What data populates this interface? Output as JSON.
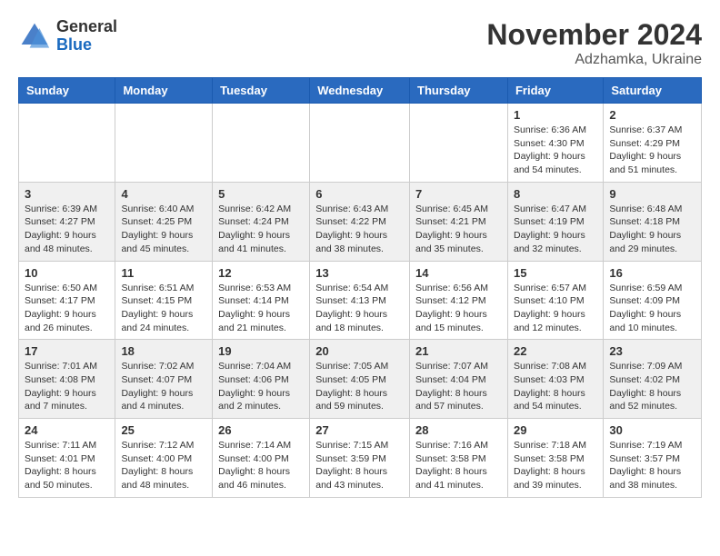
{
  "logo": {
    "general": "General",
    "blue": "Blue"
  },
  "title": "November 2024",
  "location": "Adzhamka, Ukraine",
  "days_of_week": [
    "Sunday",
    "Monday",
    "Tuesday",
    "Wednesday",
    "Thursday",
    "Friday",
    "Saturday"
  ],
  "weeks": [
    [
      {
        "day": "",
        "info": ""
      },
      {
        "day": "",
        "info": ""
      },
      {
        "day": "",
        "info": ""
      },
      {
        "day": "",
        "info": ""
      },
      {
        "day": "",
        "info": ""
      },
      {
        "day": "1",
        "info": "Sunrise: 6:36 AM\nSunset: 4:30 PM\nDaylight: 9 hours and 54 minutes."
      },
      {
        "day": "2",
        "info": "Sunrise: 6:37 AM\nSunset: 4:29 PM\nDaylight: 9 hours and 51 minutes."
      }
    ],
    [
      {
        "day": "3",
        "info": "Sunrise: 6:39 AM\nSunset: 4:27 PM\nDaylight: 9 hours and 48 minutes."
      },
      {
        "day": "4",
        "info": "Sunrise: 6:40 AM\nSunset: 4:25 PM\nDaylight: 9 hours and 45 minutes."
      },
      {
        "day": "5",
        "info": "Sunrise: 6:42 AM\nSunset: 4:24 PM\nDaylight: 9 hours and 41 minutes."
      },
      {
        "day": "6",
        "info": "Sunrise: 6:43 AM\nSunset: 4:22 PM\nDaylight: 9 hours and 38 minutes."
      },
      {
        "day": "7",
        "info": "Sunrise: 6:45 AM\nSunset: 4:21 PM\nDaylight: 9 hours and 35 minutes."
      },
      {
        "day": "8",
        "info": "Sunrise: 6:47 AM\nSunset: 4:19 PM\nDaylight: 9 hours and 32 minutes."
      },
      {
        "day": "9",
        "info": "Sunrise: 6:48 AM\nSunset: 4:18 PM\nDaylight: 9 hours and 29 minutes."
      }
    ],
    [
      {
        "day": "10",
        "info": "Sunrise: 6:50 AM\nSunset: 4:17 PM\nDaylight: 9 hours and 26 minutes."
      },
      {
        "day": "11",
        "info": "Sunrise: 6:51 AM\nSunset: 4:15 PM\nDaylight: 9 hours and 24 minutes."
      },
      {
        "day": "12",
        "info": "Sunrise: 6:53 AM\nSunset: 4:14 PM\nDaylight: 9 hours and 21 minutes."
      },
      {
        "day": "13",
        "info": "Sunrise: 6:54 AM\nSunset: 4:13 PM\nDaylight: 9 hours and 18 minutes."
      },
      {
        "day": "14",
        "info": "Sunrise: 6:56 AM\nSunset: 4:12 PM\nDaylight: 9 hours and 15 minutes."
      },
      {
        "day": "15",
        "info": "Sunrise: 6:57 AM\nSunset: 4:10 PM\nDaylight: 9 hours and 12 minutes."
      },
      {
        "day": "16",
        "info": "Sunrise: 6:59 AM\nSunset: 4:09 PM\nDaylight: 9 hours and 10 minutes."
      }
    ],
    [
      {
        "day": "17",
        "info": "Sunrise: 7:01 AM\nSunset: 4:08 PM\nDaylight: 9 hours and 7 minutes."
      },
      {
        "day": "18",
        "info": "Sunrise: 7:02 AM\nSunset: 4:07 PM\nDaylight: 9 hours and 4 minutes."
      },
      {
        "day": "19",
        "info": "Sunrise: 7:04 AM\nSunset: 4:06 PM\nDaylight: 9 hours and 2 minutes."
      },
      {
        "day": "20",
        "info": "Sunrise: 7:05 AM\nSunset: 4:05 PM\nDaylight: 8 hours and 59 minutes."
      },
      {
        "day": "21",
        "info": "Sunrise: 7:07 AM\nSunset: 4:04 PM\nDaylight: 8 hours and 57 minutes."
      },
      {
        "day": "22",
        "info": "Sunrise: 7:08 AM\nSunset: 4:03 PM\nDaylight: 8 hours and 54 minutes."
      },
      {
        "day": "23",
        "info": "Sunrise: 7:09 AM\nSunset: 4:02 PM\nDaylight: 8 hours and 52 minutes."
      }
    ],
    [
      {
        "day": "24",
        "info": "Sunrise: 7:11 AM\nSunset: 4:01 PM\nDaylight: 8 hours and 50 minutes."
      },
      {
        "day": "25",
        "info": "Sunrise: 7:12 AM\nSunset: 4:00 PM\nDaylight: 8 hours and 48 minutes."
      },
      {
        "day": "26",
        "info": "Sunrise: 7:14 AM\nSunset: 4:00 PM\nDaylight: 8 hours and 46 minutes."
      },
      {
        "day": "27",
        "info": "Sunrise: 7:15 AM\nSunset: 3:59 PM\nDaylight: 8 hours and 43 minutes."
      },
      {
        "day": "28",
        "info": "Sunrise: 7:16 AM\nSunset: 3:58 PM\nDaylight: 8 hours and 41 minutes."
      },
      {
        "day": "29",
        "info": "Sunrise: 7:18 AM\nSunset: 3:58 PM\nDaylight: 8 hours and 39 minutes."
      },
      {
        "day": "30",
        "info": "Sunrise: 7:19 AM\nSunset: 3:57 PM\nDaylight: 8 hours and 38 minutes."
      }
    ]
  ]
}
